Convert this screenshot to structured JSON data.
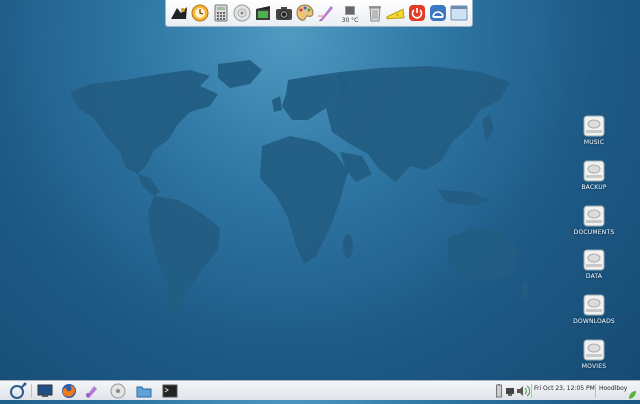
{
  "dock": {
    "items": [
      {
        "name": "terminal-app-icon"
      },
      {
        "name": "clock-app-icon"
      },
      {
        "name": "calculator-icon"
      },
      {
        "name": "disk-utility-icon"
      },
      {
        "name": "movie-editor-icon"
      },
      {
        "name": "camera-icon"
      },
      {
        "name": "paint-palette-icon"
      },
      {
        "name": "drawing-tool-icon"
      }
    ],
    "temperature": "30 °C",
    "tail_items": [
      {
        "name": "trash-icon"
      },
      {
        "name": "cheese-icon"
      },
      {
        "name": "power-icon"
      },
      {
        "name": "network-icon"
      },
      {
        "name": "desktop-show-icon"
      }
    ]
  },
  "desktop": {
    "drives": [
      {
        "label": "MUSIC"
      },
      {
        "label": "BACKUP"
      },
      {
        "label": "DOCUMENTS"
      },
      {
        "label": "DATA"
      },
      {
        "label": "DOWNLOADS"
      },
      {
        "label": "MOVIES"
      }
    ]
  },
  "panel": {
    "clock": "Fri Oct 23, 12:05 PM",
    "user": "Hoodlboy"
  },
  "colors": {
    "desktop_bg": "#2f77a4",
    "map": "#235d83",
    "power_red": "#e03b24"
  }
}
